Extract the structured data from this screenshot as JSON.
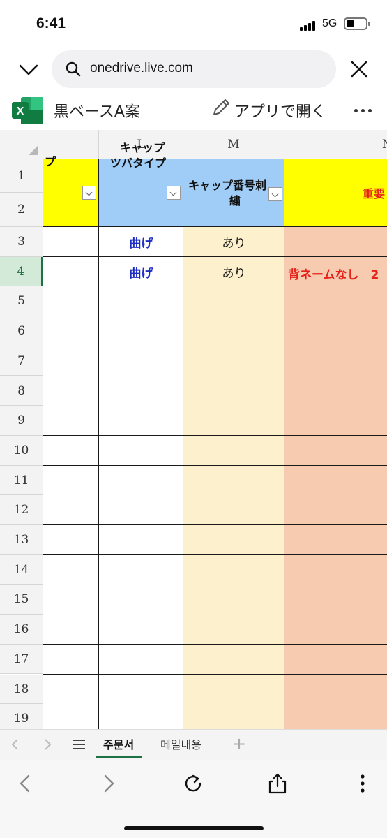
{
  "status_bar": {
    "time": "6:41",
    "network": "5G"
  },
  "browser": {
    "url": "onedrive.live.com",
    "icons": [
      "chevron-down-icon",
      "search-icon",
      "close-icon"
    ]
  },
  "app_bar": {
    "file_name": "黒ベースA案",
    "open_in_app_label": "アプリで開く",
    "icons": [
      "excel-icon",
      "pencil-icon",
      "more-icon"
    ]
  },
  "sheet": {
    "column_headers": [
      "L",
      "M",
      "N"
    ],
    "row_numbers": [
      "1",
      "2",
      "3",
      "4",
      "5",
      "6",
      "7",
      "8",
      "9",
      "10",
      "11",
      "12",
      "13",
      "14",
      "15",
      "16",
      "17",
      "18",
      "19"
    ],
    "selected_row": "4",
    "header_row": {
      "k_partial": "プ",
      "l_line1": "キャップ",
      "l_line2": "ツバタイプ",
      "m_line1": "キャップ番号刺",
      "m_line2": "繍",
      "n_partial": "重要"
    },
    "rows": [
      {
        "row": "3",
        "l": "曲げ",
        "m": "あり",
        "n": ""
      },
      {
        "row": "4",
        "l": "曲げ",
        "m": "あり",
        "n": "背ネームなし　2"
      }
    ],
    "colors": {
      "header_yellow": "#ffff00",
      "header_blue": "#9fcdf7",
      "column_m_fill": "#fdf0cc",
      "column_n_fill": "#f7cbb0",
      "value_blue": "#1c2cc4",
      "value_red": "#e5211a",
      "selection_green": "#1e7145"
    }
  },
  "sheet_tabs": {
    "tabs": [
      "주문서",
      "메일내용"
    ],
    "active_tab": "주문서",
    "icons": [
      "chevron-left-icon",
      "chevron-right-icon",
      "menu-icon",
      "plus-icon"
    ]
  },
  "browser_toolbar": {
    "icons": [
      "back-icon",
      "forward-icon",
      "reload-icon",
      "share-icon",
      "more-vertical-icon"
    ]
  }
}
